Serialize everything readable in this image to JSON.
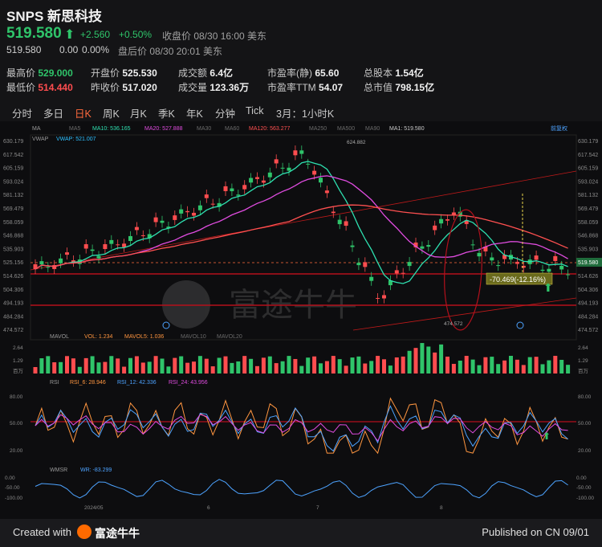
{
  "header": {
    "symbol": "SNPS",
    "name": "新思科技",
    "price": "519.580",
    "change": "+2.560",
    "change_pct": "+0.50%",
    "close_label": "收盘价 08/30 16:00 美东",
    "after_price": "519.580",
    "after_change": "0.00",
    "after_pct": "0.00%",
    "after_label": "盘后价 08/30 20:01 美东"
  },
  "stats": {
    "high_label": "最高价",
    "high": "529.000",
    "open_label": "开盘价",
    "open": "525.530",
    "amount_label": "成交额",
    "amount": "6.4亿",
    "pe_static_label": "市盈率(静)",
    "pe_static": "65.60",
    "shares_label": "总股本",
    "shares": "1.54亿",
    "low_label": "最低价",
    "low": "514.440",
    "prev_label": "昨收价",
    "prev": "517.020",
    "volume_label": "成交量",
    "volume": "123.36万",
    "pe_ttm_label": "市盈率TTM",
    "pe_ttm": "54.07",
    "mcap_label": "总市值",
    "mcap": "798.15亿"
  },
  "tabs": [
    "分时",
    "多日",
    "日K",
    "周K",
    "月K",
    "季K",
    "年K",
    "分钟",
    "Tick",
    "3月：1小时K"
  ],
  "active_tab": "日K",
  "ma_legend": {
    "ma": "MA",
    "ma5": "MA5",
    "ma10": "MA10: 536.165",
    "ma20": "MA20: 527.888",
    "ma30": "MA30",
    "ma60": "MA60",
    "ma120": "MA120: 563.277",
    "ma250": "MA250",
    "ma500": "MA500",
    "ma90": "MA90",
    "ma1": "MA1: 519.580",
    "adjust": "前复权"
  },
  "vwap_legend": {
    "vwap": "VWAP",
    "vwap_val": "VWAP: 521.007"
  },
  "price_axis": [
    "630.179",
    "617.542",
    "605.159",
    "593.024",
    "581.132",
    "569.479",
    "558.059",
    "546.868",
    "535.903",
    "525.156",
    "514.626",
    "504.306",
    "494.193",
    "484.284",
    "474.572"
  ],
  "price_tag": "519.580",
  "high_mark": "624.882",
  "low_mark": "474.572",
  "annotation": "-70.469(-12.16%)",
  "mavol_legend": {
    "mavol": "MAVOL",
    "vol": "VOL: 1.234",
    "mavol5": "MAVOL5: 1.036",
    "mavol10": "MAVOL10",
    "mavol20": "MAVOL20"
  },
  "vol_axis": [
    "2.64",
    "1.29",
    "百万"
  ],
  "rsi_legend": {
    "rsi": "RSI",
    "rsi6": "RSI_6: 28.946",
    "rsi12": "RSI_12: 42.336",
    "rsi24": "RSI_24: 43.956"
  },
  "rsi_axis": [
    "80.00",
    "50.00",
    "20.00"
  ],
  "wmsr_legend": {
    "wmsr": "WMSR",
    "wr": "WR: -83.299"
  },
  "wmsr_axis": [
    "0.00",
    "-50.00",
    "-100.00"
  ],
  "date_axis": [
    "2024/05",
    "6",
    "7",
    "8"
  ],
  "watermark": "富途牛牛",
  "footer": {
    "created": "Created with",
    "brand": "富途牛牛",
    "published": "Published on CN 09/01"
  },
  "colors": {
    "up": "#2fc46a",
    "down": "#ff4d4f",
    "accent": "#ff6a3d"
  }
}
